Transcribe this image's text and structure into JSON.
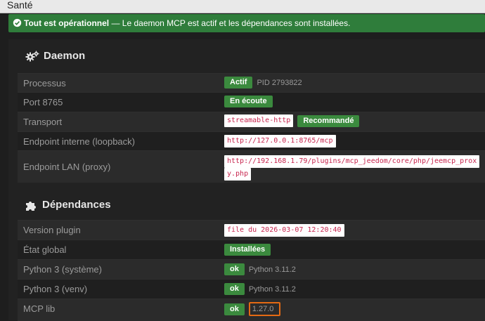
{
  "topbar": {
    "title": "Santé"
  },
  "alert": {
    "strong": "Tout est opérationnel",
    "text": " — Le daemon MCP est actif et les dépendances sont installées."
  },
  "daemon": {
    "title": "Daemon",
    "rows": [
      {
        "label": "Processus",
        "badge": "Actif",
        "extra": "PID 2793822"
      },
      {
        "label": "Port 8765",
        "badge": "En écoute"
      },
      {
        "label": "Transport",
        "code": "streamable-http",
        "badge": "Recommandé"
      },
      {
        "label": "Endpoint interne (loopback)",
        "code": "http://127.0.0.1:8765/mcp"
      },
      {
        "label": "Endpoint LAN (proxy)",
        "code_line1": "http://192.168.1.79/plugins/mcp_jeedom/core/php/jeemcp_prox",
        "code_line2": "y.php"
      }
    ]
  },
  "dependencies": {
    "title": "Dépendances",
    "rows": [
      {
        "label": "Version plugin",
        "code": "file du 2026-03-07 12:20:40"
      },
      {
        "label": "État global",
        "badge": "Installées"
      },
      {
        "label": "Python 3 (système)",
        "badge": "ok",
        "extra": "Python 3.11.2"
      },
      {
        "label": "Python 3 (venv)",
        "badge": "ok",
        "extra": "Python 3.11.2"
      },
      {
        "label": "MCP lib",
        "badge": "ok",
        "extra": "1.27.0"
      }
    ]
  },
  "colors": {
    "success": "#2f7d3b",
    "badge": "#3b8a3e",
    "code_text": "#c7254e",
    "highlight": "#e46a13"
  }
}
